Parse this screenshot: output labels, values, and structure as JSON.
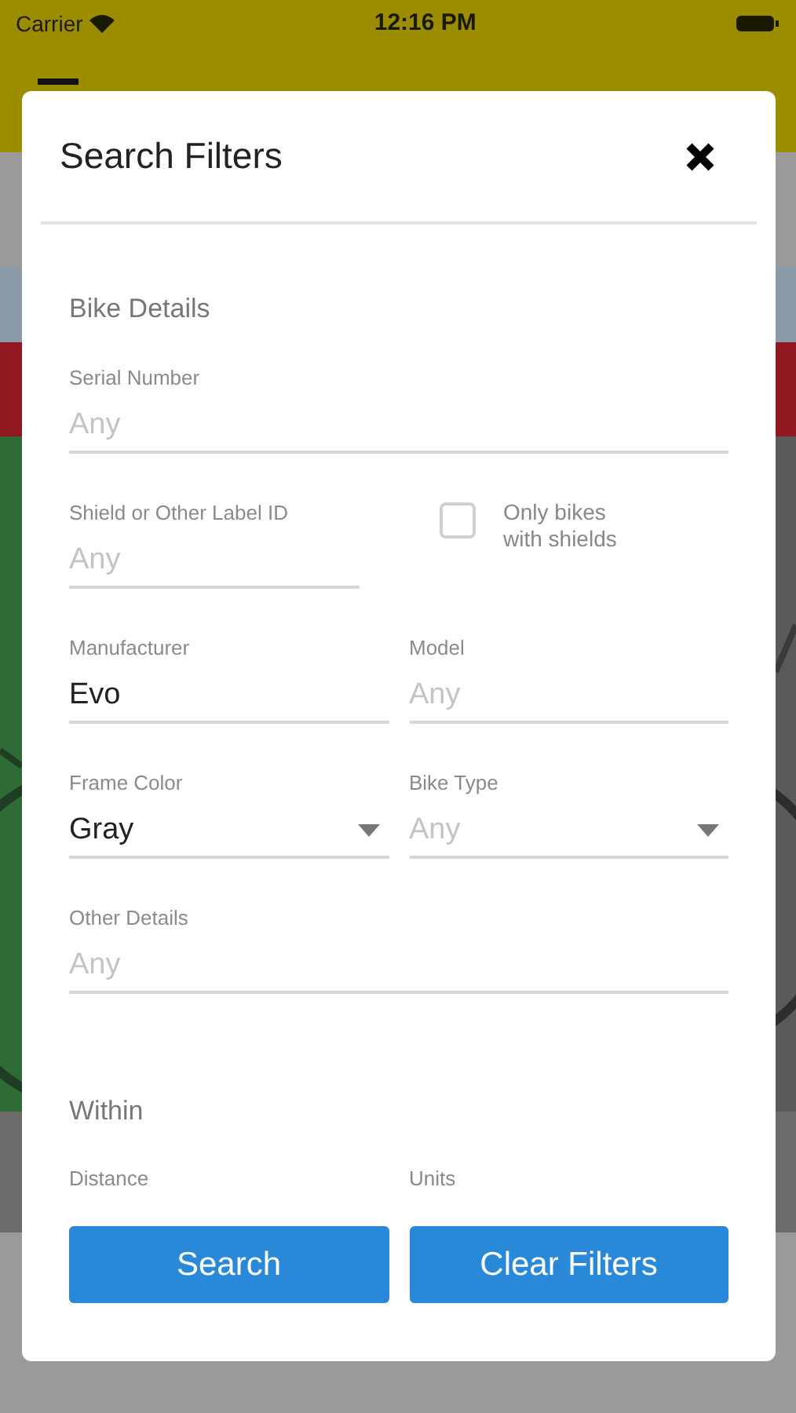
{
  "status_bar": {
    "carrier": "Carrier",
    "time": "12:16 PM"
  },
  "dialog": {
    "title": "Search Filters",
    "sections": [
      {
        "title": "Bike Details",
        "rows": [
          [
            {
              "kind": "text",
              "label": "Serial Number",
              "placeholder": "Any"
            }
          ],
          [
            {
              "kind": "text",
              "label": "Shield or Other Label ID",
              "placeholder": "Any"
            },
            {
              "kind": "checkbox",
              "label": "Only bikes with shields",
              "checked": false
            }
          ],
          [
            {
              "kind": "text",
              "label": "Manufacturer",
              "value": "Evo"
            },
            {
              "kind": "text",
              "label": "Model",
              "placeholder": "Any"
            }
          ],
          [
            {
              "kind": "select",
              "label": "Frame Color",
              "value": "Gray"
            },
            {
              "kind": "select",
              "label": "Bike Type",
              "placeholder": "Any"
            }
          ],
          [
            {
              "kind": "text",
              "label": "Other Details",
              "placeholder": "Any"
            }
          ]
        ]
      },
      {
        "title": "Within",
        "rows": [
          [
            {
              "kind": "label",
              "label": "Distance"
            },
            {
              "kind": "label",
              "label": "Units"
            }
          ]
        ]
      }
    ],
    "buttons": [
      "Search",
      "Clear Filters"
    ]
  }
}
